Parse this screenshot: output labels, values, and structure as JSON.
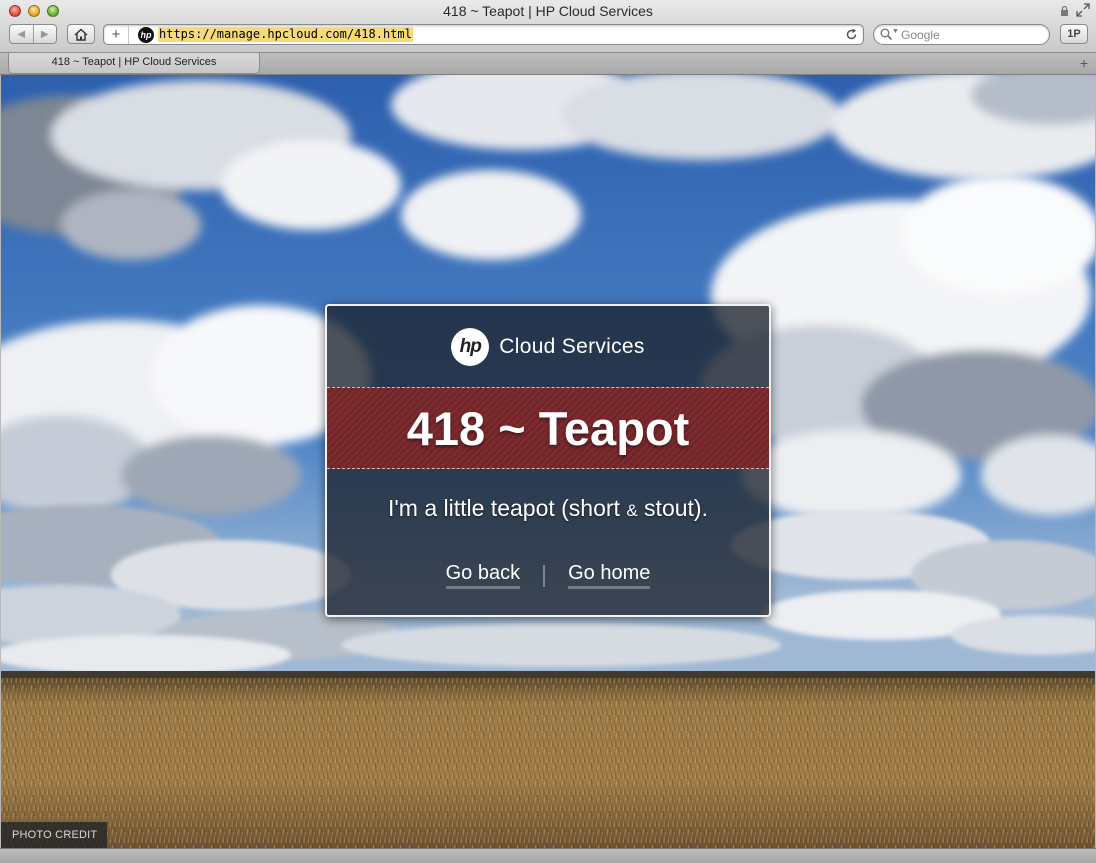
{
  "window": {
    "title": "418 ~ Teapot | HP Cloud Services"
  },
  "toolbar": {
    "favicon_text": "hp",
    "url": "https://manage.hpcloud.com/418.html",
    "search_placeholder": "Google",
    "onepassword_label": "1P"
  },
  "tabs": [
    {
      "label": "418 ~ Teapot | HP Cloud Services",
      "active": true
    }
  ],
  "card": {
    "logo_text": "hp",
    "brand": "Cloud Services",
    "error_title": "418 ~ Teapot",
    "message_before": "I'm a little teapot (short ",
    "message_amp": "&",
    "message_after": " stout).",
    "links": {
      "back": "Go back",
      "home": "Go home"
    }
  },
  "footer": {
    "photo_credit": "PHOTO CREDIT"
  },
  "colors": {
    "sky": "#3568b8",
    "error_band": "#822a2c",
    "card_bg": "#1c222e",
    "url_highlight": "#f5da77"
  }
}
